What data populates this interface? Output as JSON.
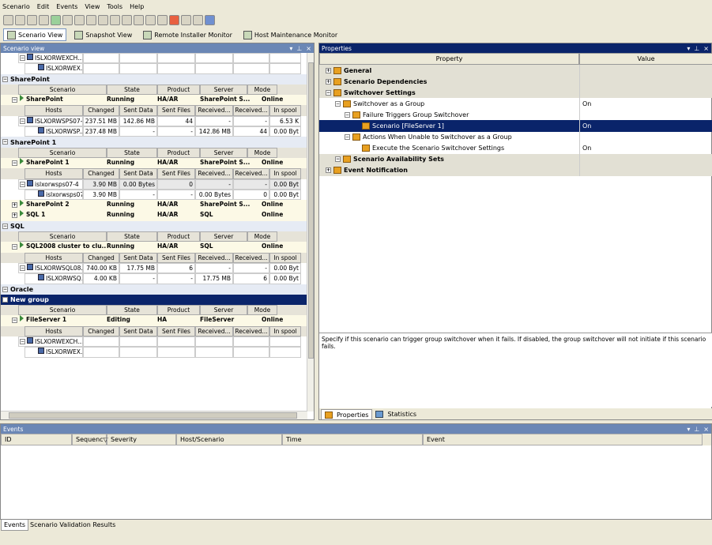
{
  "menu": [
    "Scenario",
    "Edit",
    "Events",
    "View",
    "Tools",
    "Help"
  ],
  "views": [
    {
      "label": "Scenario View",
      "active": true
    },
    {
      "label": "Snapshot View",
      "active": false
    },
    {
      "label": "Remote Installer Monitor",
      "active": false
    },
    {
      "label": "Host Maintenance Monitor",
      "active": false
    }
  ],
  "scenario_panel": {
    "title": "Scenario view"
  },
  "columns": {
    "host": [
      "Hosts",
      "Changed",
      "Sent Data",
      "Sent Files",
      "Received...",
      "Received...",
      "In spool"
    ],
    "scenario": [
      "Scenario",
      "State",
      "Product",
      "Server",
      "Mode"
    ]
  },
  "tree": [
    {
      "type": "host",
      "name": "ISLXORWEXCH...",
      "vals": [
        "",
        "",
        "",
        "",
        "",
        ""
      ],
      "indent": 1
    },
    {
      "type": "host",
      "name": "ISLXORWEX...",
      "vals": [
        "",
        "",
        "",
        "",
        "",
        ""
      ],
      "indent": 2
    },
    {
      "type": "group",
      "name": "SharePoint"
    },
    {
      "type": "shdr"
    },
    {
      "type": "scenario",
      "name": "SharePoint",
      "state": "Running",
      "product": "HA/AR",
      "server": "SharePoint S...",
      "mode": "Online"
    },
    {
      "type": "hhdr"
    },
    {
      "type": "host",
      "name": "ISLXORWSPS07-1",
      "vals": [
        "237.51 MB",
        "142.86 MB",
        "44",
        "-",
        "-",
        "6.53 K"
      ],
      "indent": 1
    },
    {
      "type": "host",
      "name": "ISLXORWSP...",
      "vals": [
        "237.48 MB",
        "-",
        "-",
        "142.86 MB",
        "44",
        "0.00 Byt"
      ],
      "indent": 2
    },
    {
      "type": "group",
      "name": "SharePoint 1"
    },
    {
      "type": "shdr"
    },
    {
      "type": "scenario",
      "name": "SharePoint 1",
      "state": "Running",
      "product": "HA/AR",
      "server": "SharePoint S...",
      "mode": "Online"
    },
    {
      "type": "hhdr"
    },
    {
      "type": "host",
      "name": "islxorwsps07-4",
      "vals": [
        "3.90 MB",
        "0.00 Bytes",
        "0",
        "-",
        "-",
        "0.00 Byt"
      ],
      "indent": 1,
      "gray": true
    },
    {
      "type": "host",
      "name": "islxorwsps07-7",
      "vals": [
        "3.90 MB",
        "-",
        "-",
        "0.00 Bytes",
        "0",
        "0.00 Byt"
      ],
      "indent": 2
    },
    {
      "type": "scenario",
      "name": "SharePoint 2",
      "state": "Running",
      "product": "HA/AR",
      "server": "SharePoint S...",
      "mode": "Online",
      "collapsed": true
    },
    {
      "type": "scenario",
      "name": "SQL 1",
      "state": "Running",
      "product": "HA/AR",
      "server": "SQL",
      "mode": "Online",
      "collapsed": true
    },
    {
      "type": "group",
      "name": "SQL"
    },
    {
      "type": "shdr"
    },
    {
      "type": "scenario",
      "name": "SQL2008 cluster to clu...",
      "state": "Running",
      "product": "HA/AR",
      "server": "SQL",
      "mode": "Online"
    },
    {
      "type": "hhdr"
    },
    {
      "type": "host",
      "name": "ISLXORWSQL08...",
      "vals": [
        "740.00 KB",
        "17.75 MB",
        "6",
        "-",
        "-",
        "0.00 Byt"
      ],
      "indent": 1
    },
    {
      "type": "host",
      "name": "ISLXORWSQ...",
      "vals": [
        "4.00 KB",
        "-",
        "-",
        "17.75 MB",
        "6",
        "0.00 Byt"
      ],
      "indent": 2
    },
    {
      "type": "group",
      "name": "Oracle"
    },
    {
      "type": "group",
      "name": "New group",
      "selected": true
    },
    {
      "type": "shdr"
    },
    {
      "type": "scenario",
      "name": "FileServer 1",
      "state": "Editing",
      "product": "HA",
      "server": "FileServer",
      "mode": "Online"
    },
    {
      "type": "hhdr"
    },
    {
      "type": "host",
      "name": "ISLXORWEXCH...",
      "vals": [
        "",
        "",
        "",
        "",
        "",
        ""
      ],
      "indent": 1
    },
    {
      "type": "host",
      "name": "ISLXORWEX...",
      "vals": [
        "",
        "",
        "",
        "",
        "",
        ""
      ],
      "indent": 2
    }
  ],
  "properties_panel": {
    "title": "Properties",
    "col_property": "Property",
    "col_value": "Value",
    "rows": [
      {
        "name": "General",
        "value": "",
        "level": 0,
        "cat": true
      },
      {
        "name": "Scenario Dependencies",
        "value": "",
        "level": 0,
        "cat": true
      },
      {
        "name": "Switchover Settings",
        "value": "",
        "level": 0,
        "cat": true
      },
      {
        "name": "Switchover as a Group",
        "value": "On",
        "level": 1
      },
      {
        "name": "Failure Triggers Group Switchover",
        "value": "",
        "level": 2
      },
      {
        "name": "Scenario [FileServer 1]",
        "value": "On",
        "level": 3,
        "selected": true
      },
      {
        "name": "Actions When Unable to Switchover as a Group",
        "value": "",
        "level": 2
      },
      {
        "name": "Execute the Scenario Switchover Settings",
        "value": "On",
        "level": 3
      },
      {
        "name": "Scenario Availability Sets",
        "value": "",
        "level": 1,
        "cat": true
      },
      {
        "name": "Event Notification",
        "value": "",
        "level": 0,
        "cat": true
      }
    ],
    "description": "Specify if this scenario can trigger group switchover when it fails. If disabled, the group switchover will not initiate if this scenario fails.",
    "tabs": [
      "Properties",
      "Statistics"
    ]
  },
  "events_panel": {
    "title": "Events",
    "columns": [
      "ID",
      "Sequenc▽",
      "Severity",
      "Host/Scenario",
      "Time",
      "Event"
    ]
  },
  "bottom_tabs": [
    "Events",
    "Scenario Validation Results"
  ]
}
